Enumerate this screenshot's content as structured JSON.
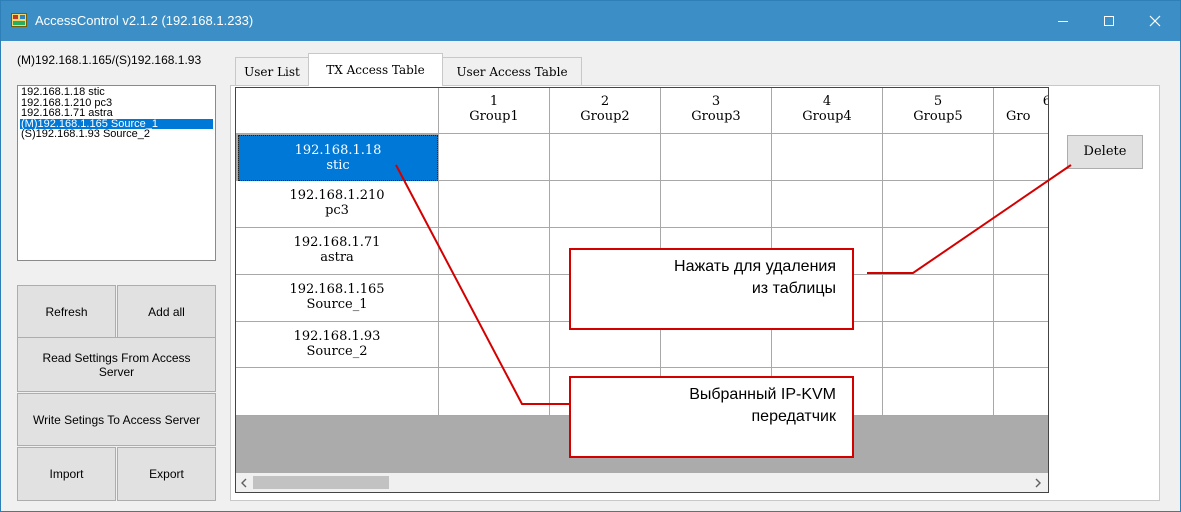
{
  "window": {
    "title": "AccessControl v2.1.2 (192.168.1.233)",
    "controls": {
      "minimize": "minimize-icon",
      "maximize": "maximize-icon",
      "close": "close-icon"
    }
  },
  "sidebar": {
    "server_label": "(M)192.168.1.165/(S)192.168.1.93",
    "devices": [
      "192.168.1.18 stic",
      "192.168.1.210 pc3",
      "192.168.1.71 astra",
      "(M)192.168.1.165 Source_1",
      "(S)192.168.1.93 Source_2"
    ],
    "selected_device": "(M)192.168.1.165 Source_1",
    "buttons": {
      "refresh": "Refresh",
      "add_all": "Add all",
      "read_settings": "Read Settings From Access Server",
      "write_settings": "Write Setings To Access Server",
      "import": "Import",
      "export": "Export"
    }
  },
  "tabs": [
    {
      "label": "User List",
      "active": false
    },
    {
      "label": "TX Access Table",
      "active": true
    },
    {
      "label": "User Access Table",
      "active": false
    }
  ],
  "table": {
    "columns": [
      {
        "num": "1",
        "name": "Group1"
      },
      {
        "num": "2",
        "name": "Group2"
      },
      {
        "num": "3",
        "name": "Group3"
      },
      {
        "num": "4",
        "name": "Group4"
      },
      {
        "num": "5",
        "name": "Group5"
      },
      {
        "num": "6",
        "name": "Gro"
      }
    ],
    "rows": [
      {
        "ip": "192.168.1.18",
        "name": "stic",
        "selected": true
      },
      {
        "ip": "192.168.1.210",
        "name": "pc3",
        "selected": false
      },
      {
        "ip": "192.168.1.71",
        "name": "astra",
        "selected": false
      },
      {
        "ip": "192.168.1.165",
        "name": "Source_1",
        "selected": false
      },
      {
        "ip": "192.168.1.93",
        "name": "Source_2",
        "selected": false
      }
    ]
  },
  "delete_button": "Delete",
  "callouts": {
    "delete_line1": "Нажать для удаления",
    "delete_line2": "из таблицы",
    "selected_line1": "Выбранный IP-KVM",
    "selected_line2": "передатчик"
  },
  "colors": {
    "titlebar": "#3c8fc6",
    "selection": "#0078d7",
    "callout_border": "#d40000"
  }
}
